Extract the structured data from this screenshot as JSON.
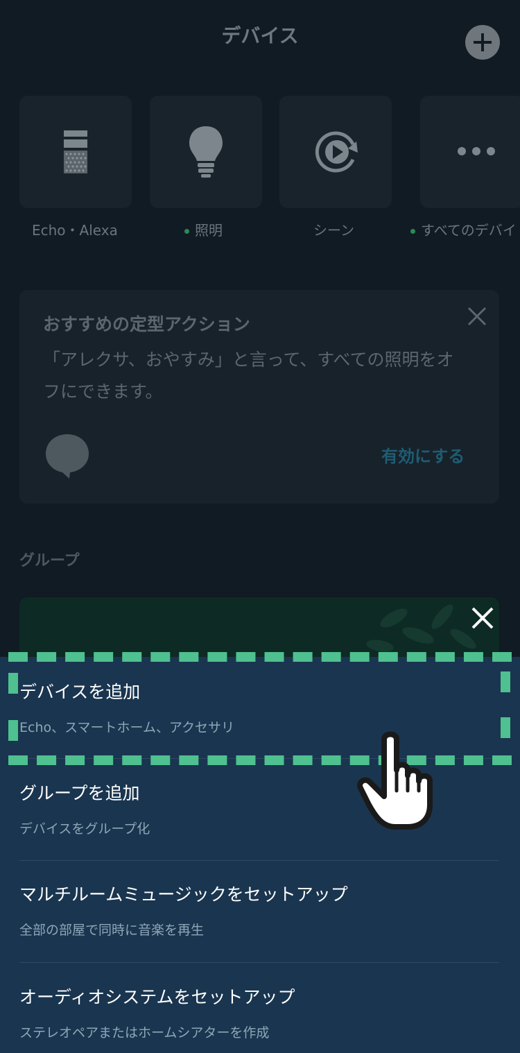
{
  "header": {
    "title": "デバイス"
  },
  "categories": [
    {
      "label": "Echo・Alexa",
      "icon": "echo-speaker-icon",
      "dot": false
    },
    {
      "label": "照明",
      "icon": "light-bulb-icon",
      "dot": true
    },
    {
      "label": "シーン",
      "icon": "scene-play-icon",
      "dot": false
    },
    {
      "label": "すべてのデバイ",
      "icon": "more-icon",
      "dot": true
    }
  ],
  "promo": {
    "title": "おすすめの定型アクション",
    "body": "「アレクサ、おやすみ」と言って、すべての照明をオフにできます。",
    "action": "有効にする"
  },
  "groups": {
    "label": "グループ"
  },
  "menu": {
    "items": [
      {
        "title": "デバイスを追加",
        "subtitle": "Echo、スマートホーム、アクセサリ"
      },
      {
        "title": "グループを追加",
        "subtitle": "デバイスをグループ化"
      },
      {
        "title": "マルチルームミュージックをセットアップ",
        "subtitle": "全部の部屋で同時に音楽を再生"
      },
      {
        "title": "オーディオシステムをセットアップ",
        "subtitle": "ステレオペアまたはホームシアターを作成"
      }
    ]
  },
  "colors": {
    "highlight": "#4fc08f",
    "sheet_bg": "#1a354f",
    "accent": "#1f5c73"
  }
}
